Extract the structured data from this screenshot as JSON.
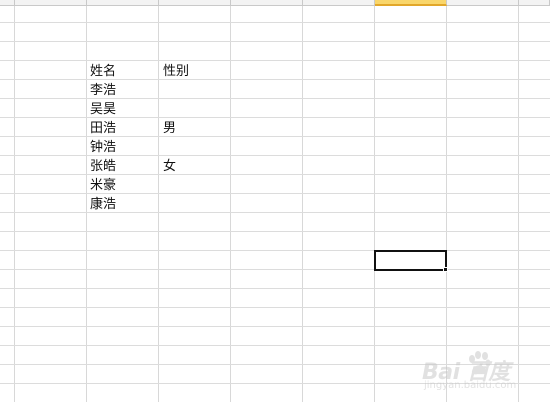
{
  "sheet": {
    "header_cells": [
      "",
      "",
      "",
      "",
      "",
      "",
      "",
      ""
    ],
    "cells": [
      {
        "row": "1",
        "name": "姓名",
        "gender": "性别"
      },
      {
        "row": "2",
        "name": "李浩",
        "gender": ""
      },
      {
        "row": "3",
        "name": "吴昊",
        "gender": ""
      },
      {
        "row": "4",
        "name": "田浩",
        "gender": "男"
      },
      {
        "row": "5",
        "name": "钟浩",
        "gender": ""
      },
      {
        "row": "6",
        "name": "张皓",
        "gender": "女"
      },
      {
        "row": "7",
        "name": "米豪",
        "gender": ""
      },
      {
        "row": "8",
        "name": "康浩",
        "gender": ""
      }
    ],
    "selected_cell_value": ""
  },
  "watermark": {
    "brand": "Bai  百度",
    "paw_icon": "baidu-paw-icon",
    "sub": "jingyan.baidu.com"
  },
  "colors": {
    "gridline": "#dcdcdc",
    "header_bg": "#f3f3f3",
    "active_header": "#f9d66b",
    "selection_border": "#111111"
  }
}
